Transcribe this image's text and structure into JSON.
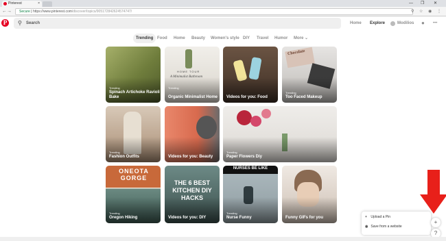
{
  "browser": {
    "tab_title": "Pinterest",
    "tab_close": "×",
    "win_minimize": "—",
    "win_restore": "❐",
    "win_close": "✕",
    "secure_label": "Secure",
    "url_host": "https://www.pinterest.com",
    "url_path": "/discover/topics/905172842624574747/",
    "nav_back": "←",
    "nav_forward": "→",
    "nav_reload": "C",
    "addr_icons": "⚲ ☆ ◉ ⋮"
  },
  "header": {
    "logo": "P",
    "search_placeholder": "Search",
    "nav_home": "Home",
    "nav_explore": "Explore",
    "nav_user": "Modilios",
    "chat_icon": "●",
    "more_icon": "•••"
  },
  "categories": [
    "Trending",
    "Food",
    "Home",
    "Beauty",
    "Women's style",
    "DIY",
    "Travel",
    "Humor",
    "More ⌄"
  ],
  "pins": [
    {
      "kicker": "Trending",
      "title": "Spinach Artichoke Ravioli Bake",
      "color": "#8a9a5b"
    },
    {
      "kicker": "Trending",
      "title": "Organic Minimalist Home",
      "color": "#e4e1da",
      "overlay_text": "HOME TOUR",
      "overlay_script": "A Minimalist Bathroom"
    },
    {
      "kicker": "",
      "title": "Videos for you: Food",
      "color": "#5a4637"
    },
    {
      "kicker": "Trending",
      "title": "Too Faced Makeup",
      "color": "#d8d6d3",
      "overlay_text": "Chocolate"
    },
    {
      "kicker": "Trending",
      "title": "Fashion Outfits",
      "color": "#c9b6a3"
    },
    {
      "kicker": "",
      "title": "Videos for you: Beauty",
      "color": "#e07e62"
    },
    {
      "kicker": "Trending",
      "title": "Paper Flowers Diy",
      "color": "#e6e4e1"
    },
    {
      "kicker": "Trending",
      "title": "Oregon Hiking",
      "color": "#c6693a",
      "overlay_text": "ONEOTA GORGE"
    },
    {
      "kicker": "",
      "title": "Videos for you: DIY",
      "color": "#4b6a6e",
      "overlay_text": "THE 6 BEST KITCHEN DIY HACKS"
    },
    {
      "kicker": "Trending",
      "title": "Nurse Funny",
      "color": "#b8c3c8",
      "overlay_text": "NURSES BE LIKE"
    },
    {
      "kicker": "",
      "title": "Funny GIFs for you",
      "color": "#d9cfc4"
    }
  ],
  "popup": {
    "upload_icon": "+",
    "upload_label": "Upload a Pin",
    "save_icon": "◉",
    "save_label": "Save from a website"
  },
  "fab": {
    "plus": "+",
    "help": "?"
  },
  "colors": {
    "brand": "#e60023",
    "arrow": "#e8201a"
  }
}
